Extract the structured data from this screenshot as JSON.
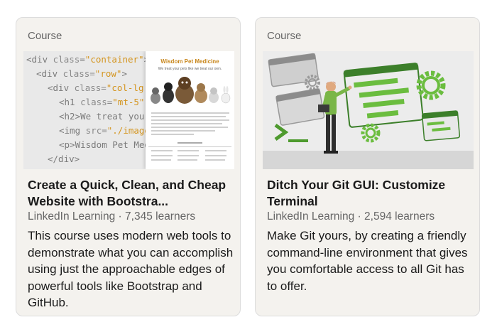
{
  "cards": [
    {
      "kind": "Course",
      "title": "Create a Quick, Clean, and Cheap Website with Bootstra...",
      "provider": "LinkedIn Learning",
      "learners": "7,345 learners",
      "description": "This course uses modern web tools to demonstrate what you can accomplish using just the approachable edges of powerful tools like Bootstrap and GitHub.",
      "thumbnail": {
        "code_lines": [
          {
            "tag": "<div ",
            "attr": "class=",
            "val": "\"container\"",
            "end": ">"
          },
          {
            "tag": "<div ",
            "attr": "class=",
            "val": "\"row\"",
            "end": ">"
          },
          {
            "tag": "<div ",
            "attr": "class=",
            "val": "\"col-lg",
            "end": ""
          },
          {
            "tag": "<h1 ",
            "attr": "class=",
            "val": "\"mt-5\"",
            "end": ""
          },
          {
            "tag": "<h2>We treat your",
            "attr": "",
            "val": "",
            "end": ""
          },
          {
            "tag": "<img ",
            "attr": "src=",
            "val": "\"./image",
            "end": ""
          },
          {
            "tag": "<p>Wisdom Pet Med",
            "attr": "",
            "val": "",
            "end": ""
          },
          {
            "tag": "</div>",
            "attr": "",
            "val": "",
            "end": ""
          }
        ],
        "doc_title": "Wisdom Pet Medicine",
        "doc_subtitle": "We treat your pets like we treat our own."
      }
    },
    {
      "kind": "Course",
      "title": "Ditch Your Git GUI: Customize Terminal",
      "provider": "LinkedIn Learning",
      "learners": "2,594 learners",
      "description": "Make Git yours, by creating a friendly command-line environment that gives you comfortable access to all Git has to offer.",
      "thumbnail": {
        "accent": "#7bb33b"
      }
    }
  ],
  "meta_separator": " · "
}
